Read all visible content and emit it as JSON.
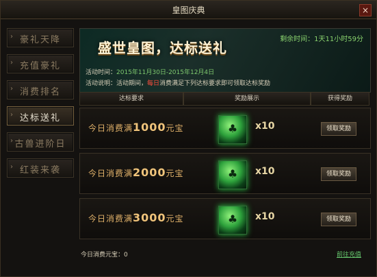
{
  "window": {
    "title": "皇图庆典",
    "close_glyph": "×"
  },
  "sidebar": {
    "items": [
      {
        "label": "豪礼天降"
      },
      {
        "label": "充值豪礼"
      },
      {
        "label": "消费排名"
      },
      {
        "label": "达标送礼"
      },
      {
        "label": "古兽进阶日"
      },
      {
        "label": "红装来袭"
      }
    ],
    "active_index": 3
  },
  "banner": {
    "title": "盛世皇图，达标送礼",
    "countdown": "剩余时间：1天11小时59分",
    "time_label": "活动时间：",
    "time_value": "2015年11月30日-2015年12月4日",
    "desc_label": "活动说明：",
    "desc_prefix": "活动期间，",
    "desc_highlight": "每日",
    "desc_suffix": "消费满足下列达标要求即可领取达标奖励"
  },
  "table": {
    "headers": [
      "达标要求",
      "奖励展示",
      "获得奖励"
    ],
    "rows": [
      {
        "text_prefix": "今日消费满",
        "amount": "1000",
        "text_suffix": "元宝",
        "qty": "x10",
        "button": "领取奖励"
      },
      {
        "text_prefix": "今日消费满",
        "amount": "2000",
        "text_suffix": "元宝",
        "qty": "x10",
        "button": "领取奖励"
      },
      {
        "text_prefix": "今日消费满",
        "amount": "3000",
        "text_suffix": "元宝",
        "qty": "x10",
        "button": "领取奖励"
      }
    ]
  },
  "footer": {
    "today_spent_label": "今日消费元宝：",
    "today_spent_value": "0",
    "recharge_link": "前往充值"
  },
  "icons": {
    "reward_item": "jade-paw-icon",
    "nav_arrow": "arrow-right-icon",
    "close": "close-icon"
  },
  "colors": {
    "accent_green": "#7ec86e",
    "accent_red": "#ff4f3d",
    "gold": "#f0c47b"
  }
}
